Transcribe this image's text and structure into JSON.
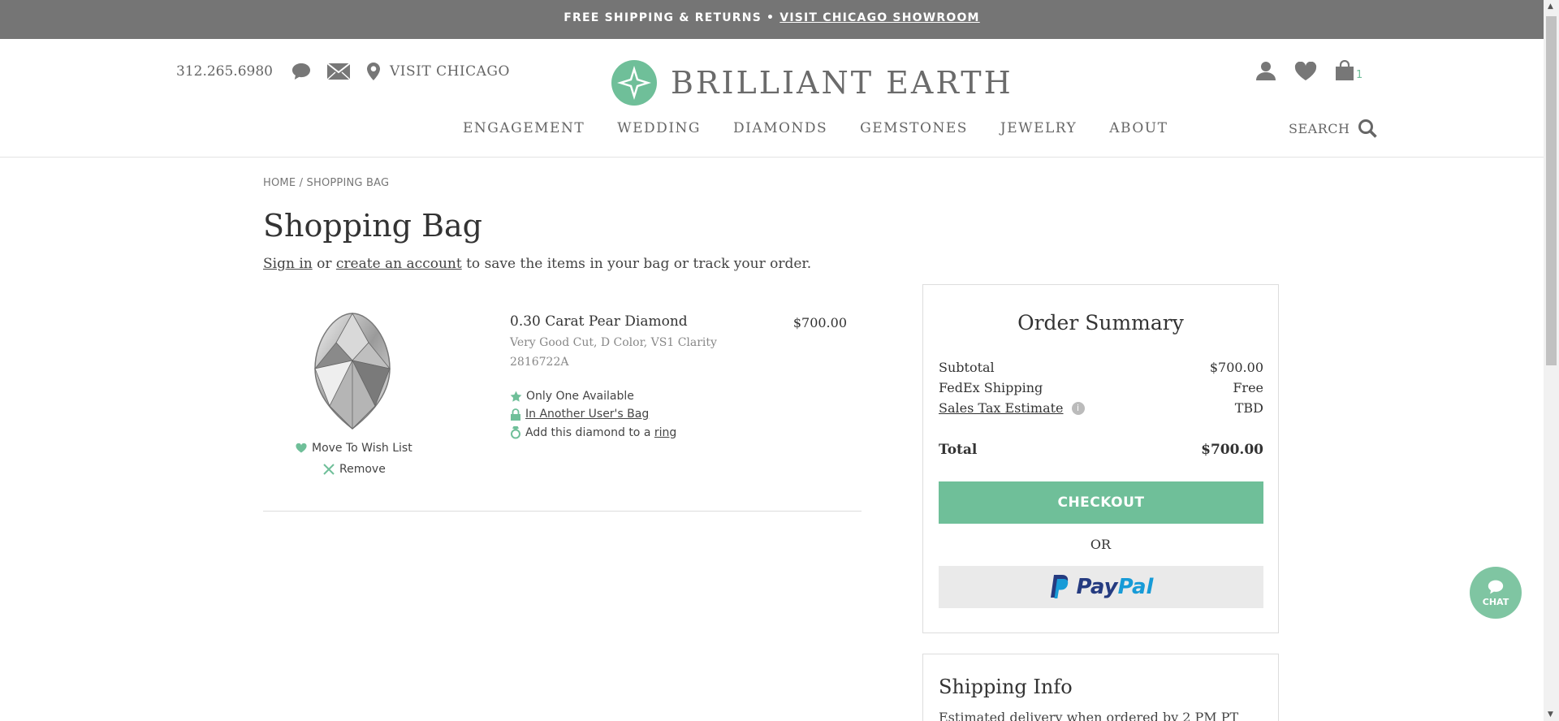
{
  "topbar": {
    "text": "FREE SHIPPING & RETURNS •",
    "link": "VISIT CHICAGO SHOWROOM"
  },
  "header": {
    "phone": "312.265.6980",
    "visit": "VISIT CHICAGO",
    "brand": "BRILLIANT EARTH",
    "bag_count": "1",
    "search_label": "SEARCH",
    "nav": [
      "ENGAGEMENT",
      "WEDDING",
      "DIAMONDS",
      "GEMSTONES",
      "JEWELRY",
      "ABOUT"
    ]
  },
  "breadcrumb": {
    "home": "HOME",
    "sep": "/",
    "current": "SHOPPING BAG"
  },
  "page": {
    "title": "Shopping Bag",
    "sign_in": "Sign in",
    "or": "or",
    "create_account": "create an account",
    "suffix": "to save the items in your bag or track your order."
  },
  "item": {
    "title": "0.30 Carat Pear Diamond",
    "price": "$700.00",
    "spec": "Very Good Cut, D Color, VS1 Clarity",
    "sku": "2816722A",
    "only_one": "Only One Available",
    "another_bag": "In Another User's Bag",
    "add_prefix": "Add this diamond to a",
    "add_link": "ring",
    "wish_label": "Move To Wish List",
    "remove_label": "Remove"
  },
  "summary": {
    "title": "Order Summary",
    "subtotal_label": "Subtotal",
    "subtotal_value": "$700.00",
    "shipping_label": "FedEx Shipping",
    "shipping_value": "Free",
    "tax_label": "Sales Tax Estimate",
    "tax_value": "TBD",
    "info_icon": "i",
    "total_label": "Total",
    "total_value": "$700.00",
    "checkout_label": "CHECKOUT",
    "or_label": "OR",
    "paypal_pay": "Pay",
    "paypal_pal": "Pal"
  },
  "shipping": {
    "title": "Shipping Info",
    "text": "Estimated delivery when ordered by 2 PM PT"
  },
  "chat": {
    "label": "CHAT"
  },
  "colors": {
    "accent": "#6fbf99",
    "topbar": "#757575"
  }
}
